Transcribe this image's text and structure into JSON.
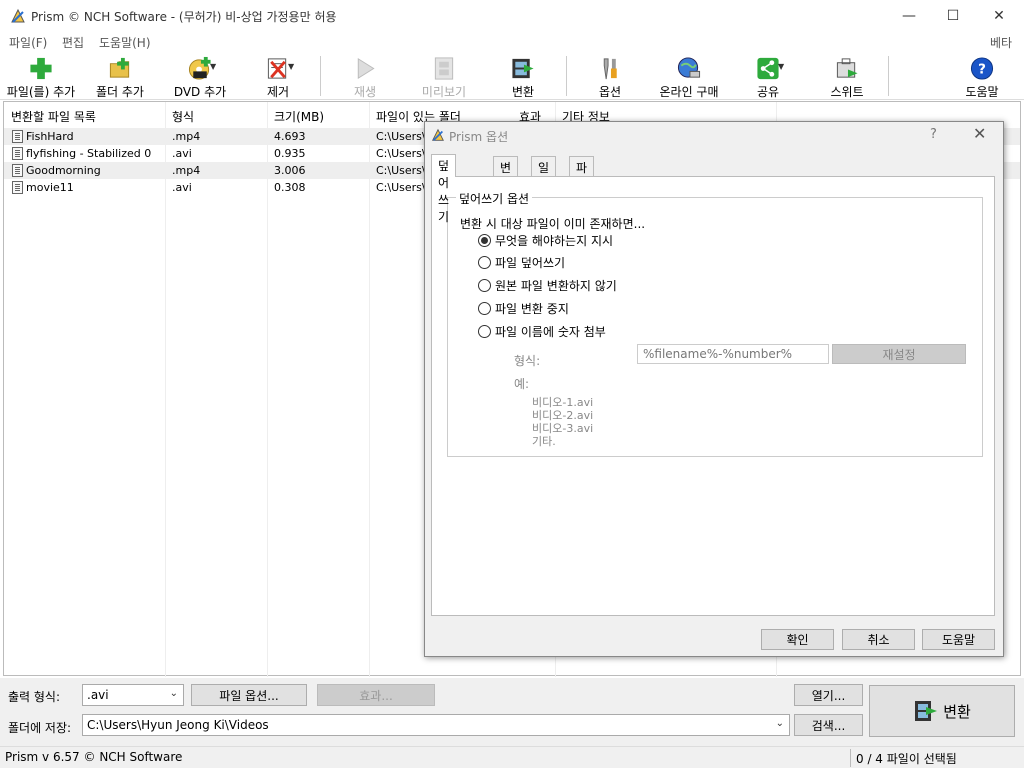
{
  "window": {
    "title": "Prism © NCH Software - (무허가) 비-상업 가정용만 허용",
    "minimize": "—",
    "maximize": "☐",
    "close": "✕"
  },
  "menu": {
    "items": [
      "파일(F)",
      "편집",
      "도움말(H)"
    ],
    "beta": "베타"
  },
  "toolbar": {
    "add_file": "파일(를) 추가",
    "add_folder": "폴더 추가",
    "add_dvd": "DVD 추가",
    "remove": "제거",
    "play": "재생",
    "preview": "미리보기",
    "convert": "변환",
    "options": "옵션",
    "buy_online": "온라인 구매",
    "share": "공유",
    "suite": "스위트",
    "help": "도움말"
  },
  "filelist": {
    "columns": [
      "변환할 파일 목록",
      "형식",
      "크기(MB)",
      "파일이 있는 폴더",
      "효과",
      "기타 정보"
    ],
    "rows": [
      {
        "name": "FishHard",
        "format": ".mp4",
        "size": "4.693",
        "folder": "C:\\Users\\"
      },
      {
        "name": "flyfishing - Stabilized 0",
        "format": ".avi",
        "size": "0.935",
        "folder": "C:\\Users\\"
      },
      {
        "name": "Goodmorning",
        "format": ".mp4",
        "size": "3.006",
        "folder": "C:\\Users\\"
      },
      {
        "name": "movie11",
        "format": ".avi",
        "size": "0.308",
        "folder": "C:\\Users\\"
      }
    ]
  },
  "bottom": {
    "output_format_label": "출력 형식:",
    "output_format_value": ".avi",
    "file_options_button": "파일 옵션...",
    "effects_button": "효과...",
    "open_button": "열기...",
    "save_to_label": "폴더에 저장:",
    "save_path": "C:\\Users\\Hyun Jeong Ki\\Videos",
    "browse_button": "검색...",
    "convert_button": "변환"
  },
  "status": {
    "version": "Prism v 6.57 © NCH Software",
    "selection": "0  / 4  파일이 선택됨"
  },
  "dialog": {
    "title": "Prism 옵션",
    "help": "?",
    "close": "✕",
    "tabs": [
      "덮어쓰기",
      "변환",
      "일반",
      "파일 속성"
    ],
    "group_title": "덮어쓰기 옵션",
    "prompt": "변환 시 대상 파일이 이미 존재하면...",
    "options": [
      "무엇을 해야하는지 지시",
      "파일 덮어쓰기",
      "원본 파일 변환하지 않기",
      "파일 변환 중지",
      "파일 이름에 숫자 첨부"
    ],
    "selected_option": 0,
    "format_label": "형식:",
    "format_value": "%filename%-%number%",
    "reset_button": "재설정",
    "example_label": "예:",
    "examples": [
      "비디오-1.avi",
      "비디오-2.avi",
      "비디오-3.avi",
      "기타."
    ],
    "ok": "확인",
    "cancel": "취소",
    "help_button": "도움말"
  },
  "colors": {
    "accent_green": "#2eaa3c",
    "help_blue": "#1a55c8"
  }
}
